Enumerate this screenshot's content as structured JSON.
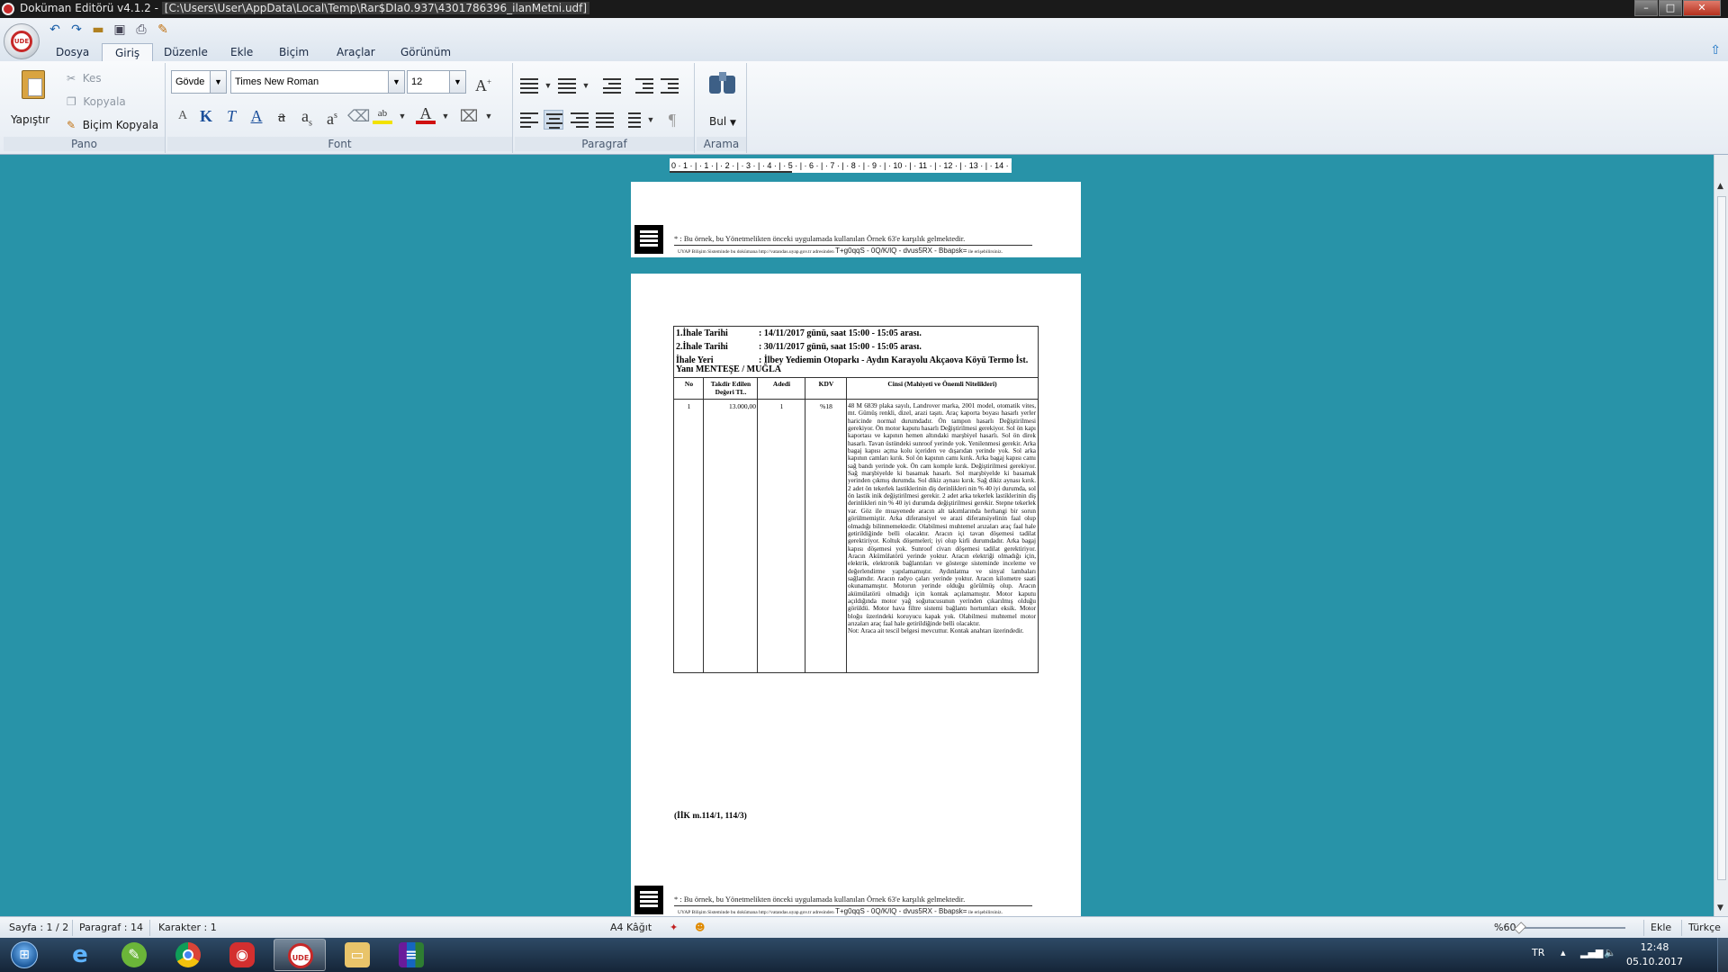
{
  "window": {
    "title_prefix": "Doküman Editörü v4.1.2 - ",
    "title_path": "[C:\\Users\\User\\AppData\\Local\\Temp\\Rar$DIa0.937\\4301786396_ilanMetni.udf]",
    "minimize": "–",
    "maximize": "□",
    "close": "✕"
  },
  "app": {
    "orb_label": "UDE"
  },
  "tabs": [
    "Dosya",
    "Giriş",
    "Düzenle",
    "Ekle",
    "Biçim",
    "Araçlar",
    "Görünüm"
  ],
  "active_tab": "Giriş",
  "ribbon": {
    "pano": {
      "label": "Pano",
      "paste": "Yapıştır",
      "cut": "Kes",
      "copy": "Kopyala",
      "format_painter": "Biçim Kopyala"
    },
    "font": {
      "label": "Font",
      "style_value": "Gövde",
      "font_value": "Times New Roman",
      "size_value": "12",
      "grow": "A",
      "shrink": "A",
      "bold": "K",
      "italic": "T",
      "underline": "A",
      "strike": "a",
      "subscript": "a",
      "superscript": "a",
      "sub_mark": "s",
      "sup_mark": "s",
      "highlight": "ab",
      "font_color": "A"
    },
    "paragraf": {
      "label": "Paragraf"
    },
    "arama": {
      "label": "Arama",
      "find": "Bul"
    }
  },
  "ruler": {
    "text": "0 · 1 · | · 1 · | · 2 · | · 3 · | · 4 · | · 5 · | · 6 · | · 7 · | · 8 · | · 9 · | · 10 · | · 11 · | · 12 · | · 13 · | · 14 · | · 15 · |"
  },
  "document": {
    "footnote": "* : Bu örnek, bu Yönetmelikten önceki uygulamada kullanılan Örnek 63'e karşılık gelmektedir.",
    "uyap_text": "UYAP Bilişim Sisteminde bu dokümana http://vatandas.uyap.gov.tr adresinden ",
    "uyap_code": "T+g0qqS - 0Q/K/lQ - dvus5RX - Bbapsk=",
    "uyap_suffix": " ile erişebilirsiniz.",
    "ihale1_label": "1.İhale Tarihi",
    "ihale1_value": ": 14/11/2017 günü, saat 15:00 - 15:05 arası.",
    "ihale2_label": "2.İhale Tarihi",
    "ihale2_value": ": 30/11/2017 günü, saat 15:00 - 15:05 arası.",
    "yer_label": "İhale Yeri",
    "yer_value": ": İlbey Yediemin Otoparkı - Aydın Karayolu Akçaova Köyü Termo İst.",
    "yer_value2": "Yanı MENTEŞE / MUĞLA",
    "table_headers": [
      "No",
      "Takdir Edilen Değeri TL.",
      "Adedi",
      "KDV",
      "Cinsi (Mahiyeti ve Önemli Nitelikleri)"
    ],
    "row": {
      "no": "1",
      "value": "13.000,00",
      "count": "1",
      "kdv": "%18",
      "description": "48 M 6839 plaka sayılı, Landrover marka, 2001 model, otomatik vites, mt. Gümüş renkli, dizel, arazi taşıtı. Araç kaporta boyası hasarlı yerler haricinde normal durumdadır. Ön tampon hasarlı Değiştirilmesi gerekiyor. Ön motor kaputu hasarlı Değiştirilmesi gerekiyor. Sol ön kapı kaportası ve kapının hemen altındaki marşbiyel hasarlı. Sol ön direk hasarlı. Tavan üstündeki sunroof yerinde yok. Yenilenmesi gerekir. Arka bagaj kapısı açma kolu içeriden ve dışarıdan yerinde yok. Sol arka kapının camları kırık. Sol ön kapının camı kırık. Arka bagaj kapısı camı sağ bandı yerinde yok. Ön cam komple kırık. Değiştirilmesi gerekiyor. Sağ marşbiyelde ki basamak hasarlı. Sol marşbiyelde ki basamak yerinden çıkmış durumda. Sol dikiz aynası kırık. Sağ dikiz aynası kırık. 2 adet ön tekerlek lastiklerinin diş derinlikleri nin % 40 iyi durumda, sol ön lastik inik değiştirilmesi gerekir. 2 adet arka tekerlek lastiklerinin diş derinlikleri nin % 40 iyi durumda değiştirilmesi gerekir. Stepne tekerlek var. Göz ile muayenede aracın alt takımlarında herhangi bir sorun görülmemiştir. Arka diferansiyel ve arazi diferansiyelinin faal olup olmadığı bilinmemektedir. Olabilmesi muhtemel arızaları araç faal hale getirildiğinde belli olacaktır. Aracın içi tavan döşemesi tadilat gerektiriyor. Koltuk döşemeleri; iyi olup kirli durumdadır. Arka bagaj kapısı döşemesi yok. Sunroof civarı döşemesi tadilat gerektiriyor. Aracın Akümülatörü yerinde yoktur. Aracın elektriği olmadığı için, elektrik, elektronik bağlantıları ve gösterge sisteminde inceleme ve değerlendirme yapılamamıştır. Aydınlatma ve sinyal lambaları sağlamdır. Aracın radyo çaları yerinde yoktur. Aracın kilometre saati okunamamıştır. Motorun yerinde olduğu görülmüş olup. Aracın akümülatörü olmadığı için kontak açılamamıştır. Motor kaputu açıldığında motor yağ soğutucusunun yerinden çıkarılmış olduğu görüldü. Motor hava filtre sistemi bağlantı hortumları eksik. Motor bloğu üzerindeki koruyucu kapak yok. Olabilmesi muhtemel motor arızaları araç faal hale getirildiğinde belli olacaktır.",
      "note": "Not: Araca ait tescil belgesi mevcuttur. Kontak anahtarı üzerindedir."
    },
    "iik": "(İİK m.114/1, 114/3)"
  },
  "statusbar": {
    "page": "Sayfa : 1 / 2",
    "paragraph": "Paragraf : 14",
    "chars": "Karakter : 1",
    "paper": "A4 Kâğıt",
    "zoom": "%60",
    "mode": "Ekle",
    "language": "Türkçe"
  },
  "taskbar": {
    "tray_lang": "TR",
    "time": "12:48",
    "date": "05.10.2017"
  },
  "colors": {
    "workspace": "#2893a8",
    "accent": "#c62828"
  }
}
